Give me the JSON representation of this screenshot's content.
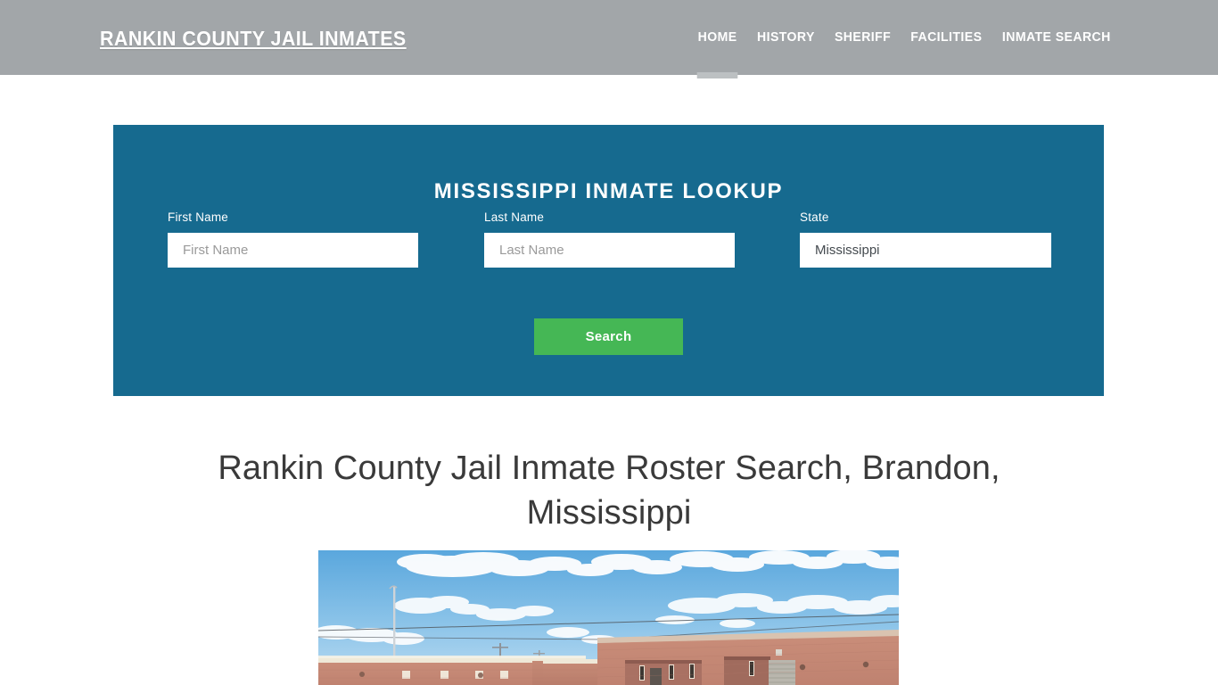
{
  "header": {
    "brand": "RANKIN COUNTY JAIL INMATES",
    "nav": [
      {
        "label": "HOME",
        "active": true
      },
      {
        "label": "HISTORY",
        "active": false
      },
      {
        "label": "SHERIFF",
        "active": false
      },
      {
        "label": "FACILITIES",
        "active": false
      },
      {
        "label": "INMATE SEARCH",
        "active": false
      }
    ],
    "background_color": "#a2a6a9",
    "text_color": "#ffffff",
    "active_indicator_color": "#bcc0c2"
  },
  "lookup": {
    "title": "MISSISSIPPI INMATE LOOKUP",
    "panel_color": "#166a8f",
    "fields": {
      "first_name": {
        "label": "First Name",
        "placeholder": "First Name",
        "value": ""
      },
      "last_name": {
        "label": "Last Name",
        "placeholder": "Last Name",
        "value": ""
      },
      "state": {
        "label": "State",
        "placeholder": "State",
        "value": "Mississippi",
        "options": [
          "Mississippi"
        ]
      }
    },
    "search_button": {
      "label": "Search",
      "color": "#45b755"
    }
  },
  "main": {
    "heading": "Rankin County Jail Inmate Roster Search, Brandon, Mississippi",
    "photo_alt": "Rankin County Jail building exterior",
    "photo_caption": ""
  }
}
